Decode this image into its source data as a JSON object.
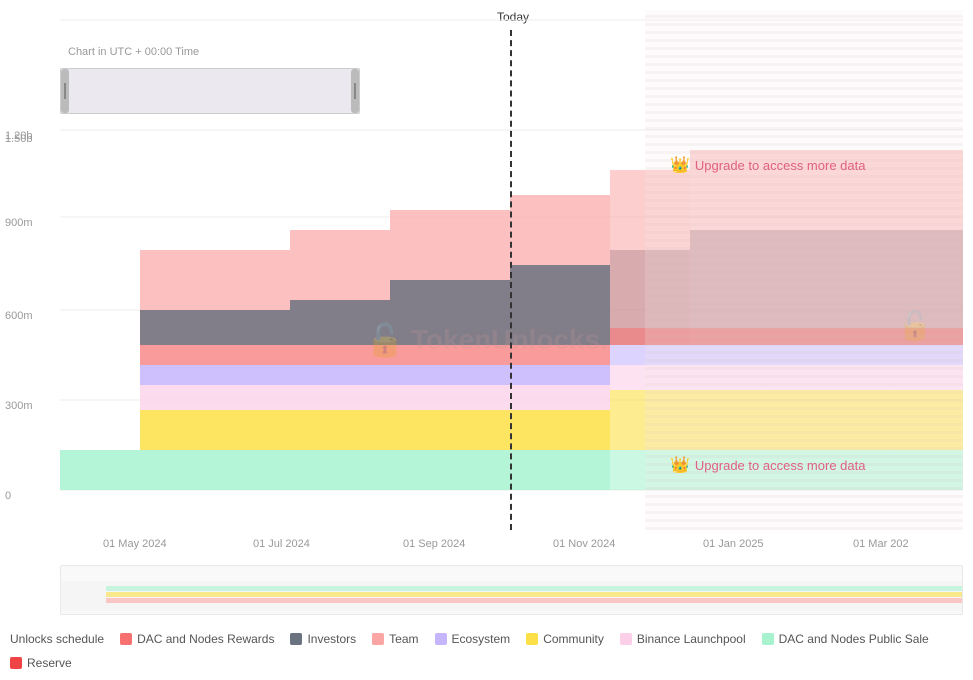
{
  "chart": {
    "title": "Chart in UTC + 00:00 Time",
    "today_label": "Today",
    "watermark_text": "TokenUnlocks.",
    "watermark_lock": "🔓",
    "upgrade_top": "Upgrade to access more data",
    "upgrade_bottom": "Upgrade to access more data",
    "y_labels": [
      "0",
      "300m",
      "600m",
      "900m",
      "1.20b",
      "1.50b"
    ],
    "x_labels": [
      "01 May 2024",
      "01 Jul 2024",
      "01 Sep 2024",
      "01 Nov 2024",
      "01 Jan 2025",
      "01 Mar 202"
    ],
    "colors": {
      "dac_nodes_rewards": "#f87171",
      "investors": "#6b7280",
      "team": "#fca5a5",
      "ecosystem": "#a78bfa",
      "community": "#fde68a",
      "binance_launchpool": "#f9a8d4",
      "dac_nodes_public_sale": "#a7f3d0",
      "reserve": "#ef4444"
    }
  },
  "legend": {
    "items": [
      {
        "label": "Unlocks schedule",
        "color": null,
        "type": "text"
      },
      {
        "label": "DAC and Nodes Rewards",
        "color": "#f87171",
        "type": "dot"
      },
      {
        "label": "Investors",
        "color": "#6b7280",
        "type": "dot"
      },
      {
        "label": "Team",
        "color": "#fca5a5",
        "type": "dot"
      },
      {
        "label": "Ecosystem",
        "color": "#a78bfa",
        "type": "dot"
      },
      {
        "label": "Community",
        "color": "#fde047",
        "type": "dot"
      },
      {
        "label": "Binance Launchpool",
        "color": "#fbcfe8",
        "type": "dot"
      },
      {
        "label": "DAC and Nodes Public Sale",
        "color": "#a7f3d0",
        "type": "dot"
      },
      {
        "label": "Reserve",
        "color": "#ef4444",
        "type": "dot"
      }
    ]
  }
}
